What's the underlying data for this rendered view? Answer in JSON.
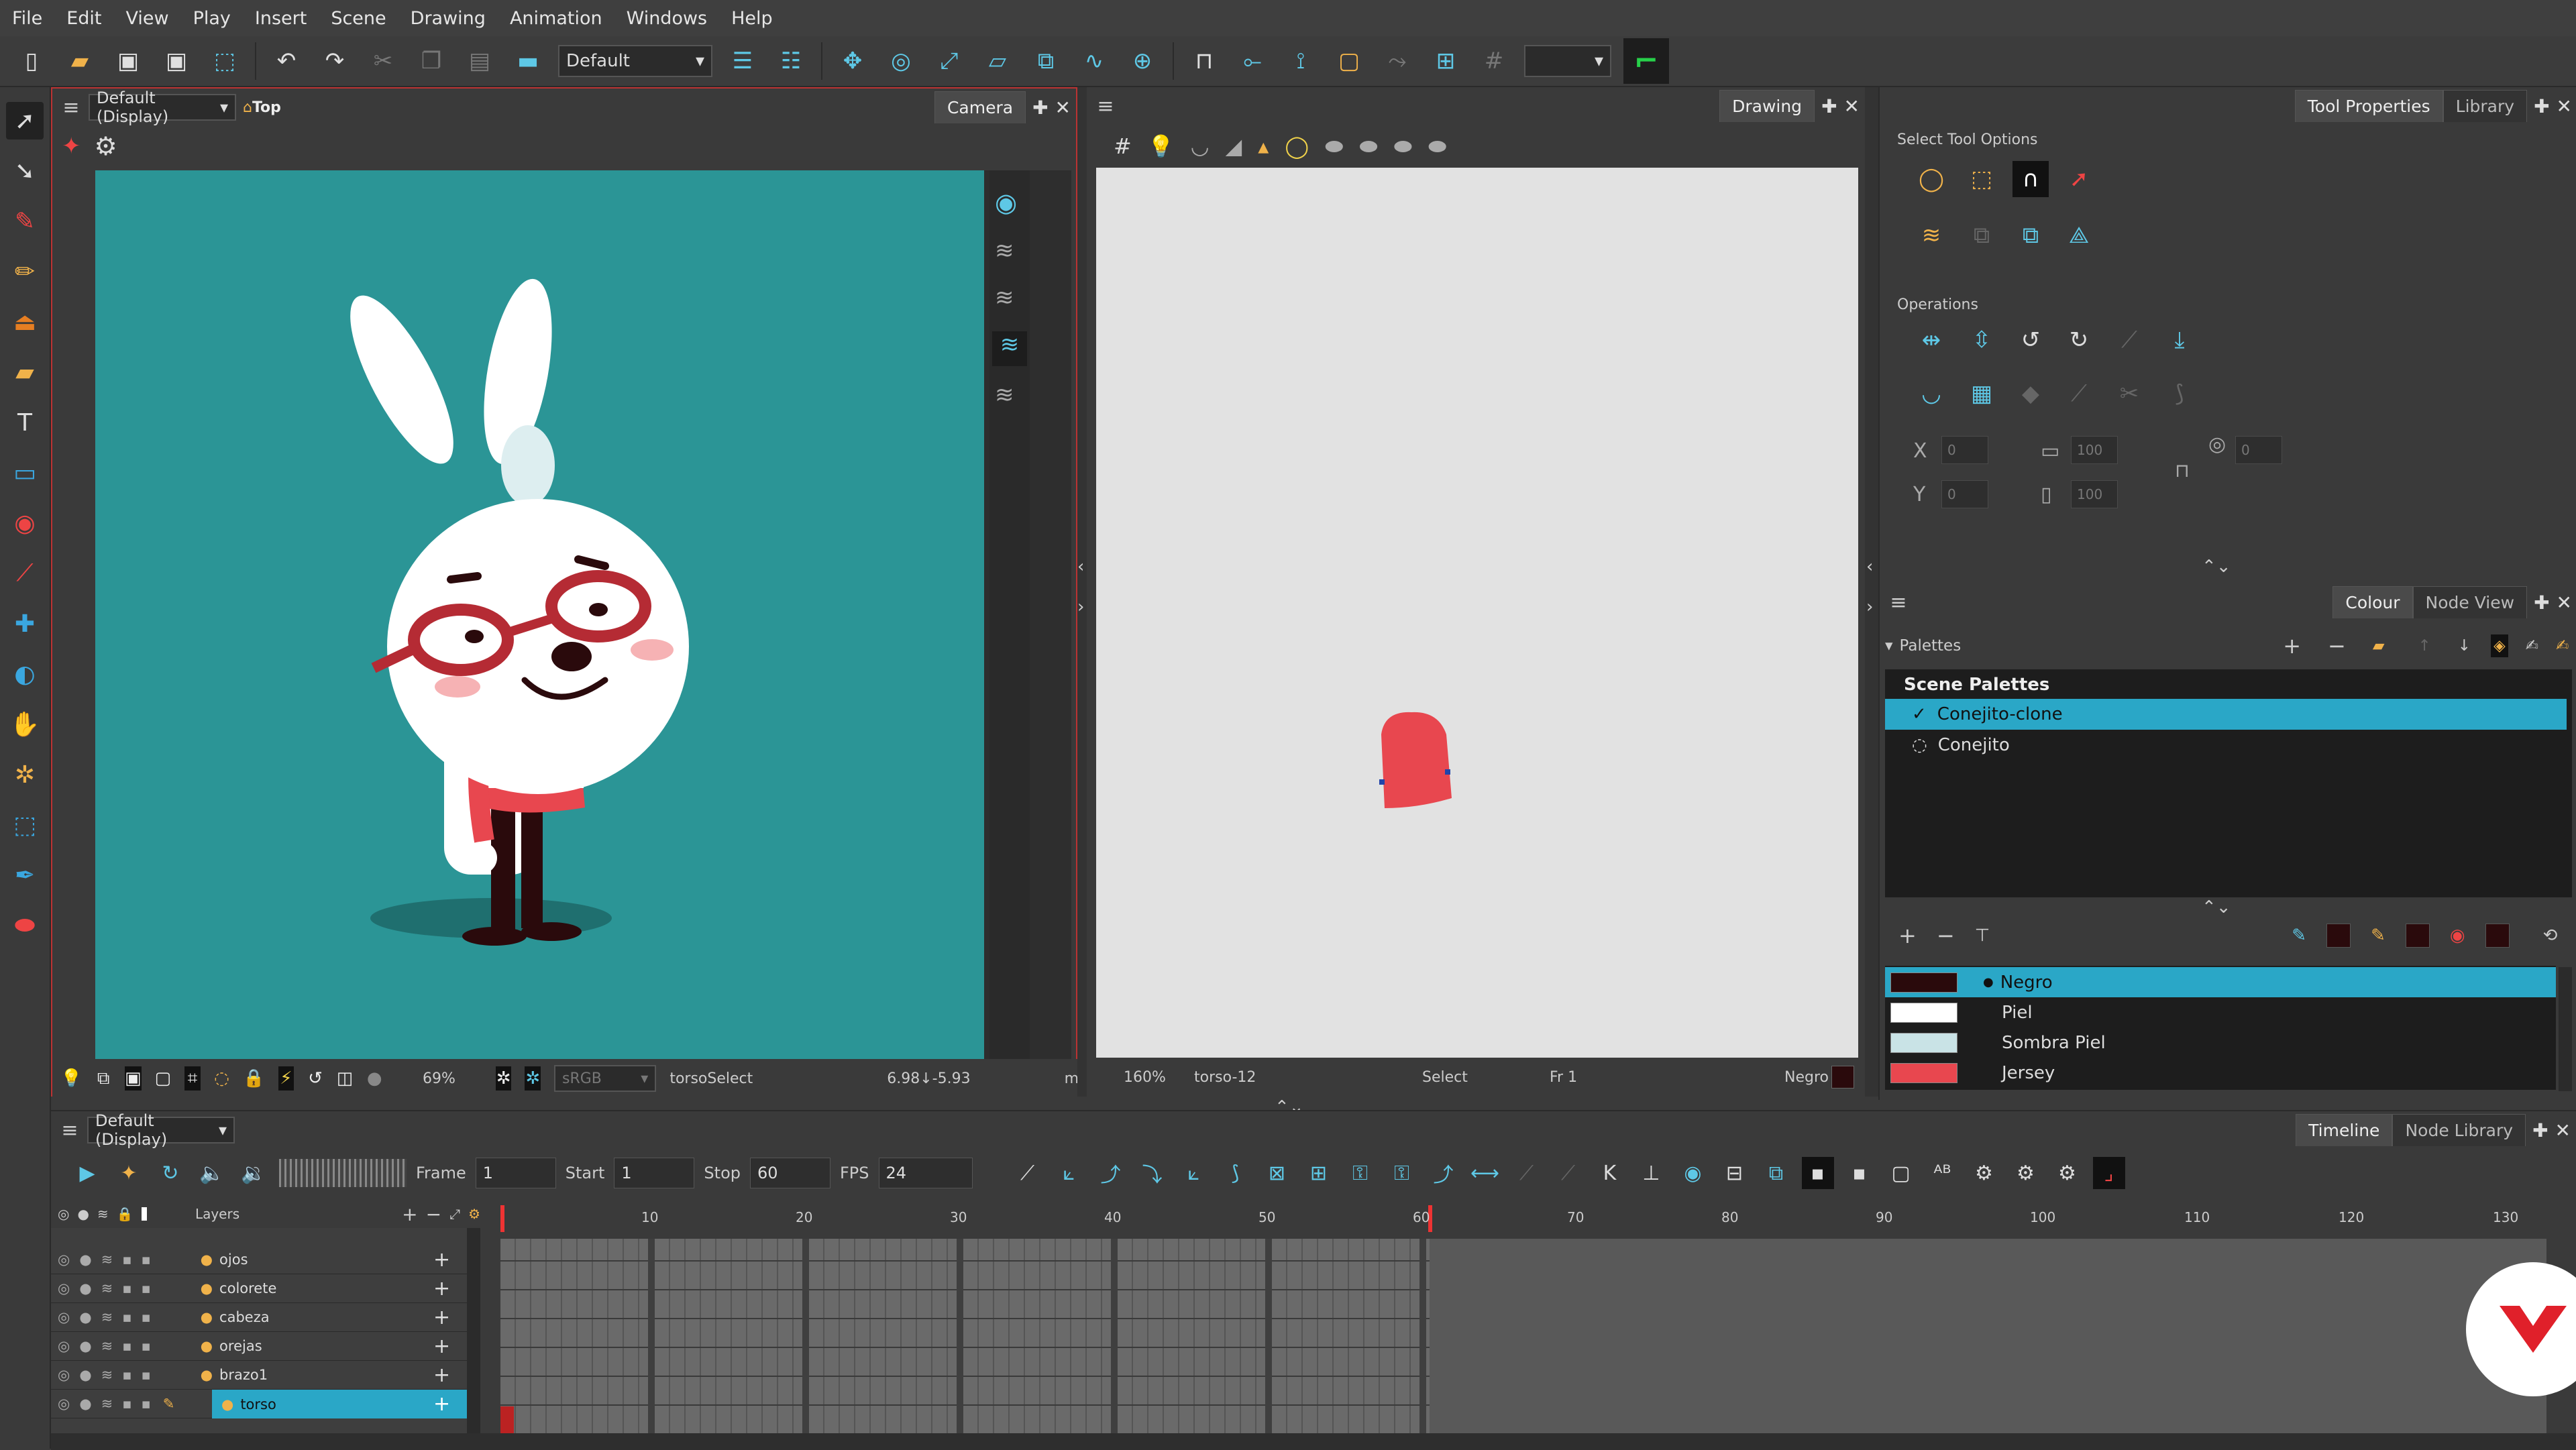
{
  "menu": [
    "File",
    "Edit",
    "View",
    "Play",
    "Insert",
    "Scene",
    "Drawing",
    "Animation",
    "Windows",
    "Help"
  ],
  "toolbar": {
    "workspace": "Default"
  },
  "camera_view": {
    "display": "Default (Display)",
    "view_mode": "Top",
    "tab": "Camera",
    "zoom": "69%",
    "color_space": "sRGB",
    "tool_label": "torsoSelect",
    "coords": "6.98↓-5.93",
    "unit": "m"
  },
  "drawing_view": {
    "tab": "Drawing",
    "zoom": "160%",
    "drawing_name": "torso-12",
    "tool": "Select",
    "frame": "Fr 1",
    "colour": "Negro"
  },
  "tool_properties": {
    "tabs": [
      "Tool Properties",
      "Library"
    ],
    "select_options_label": "Select Tool Options",
    "operations_label": "Operations",
    "fields": {
      "x": "0",
      "y": "0",
      "w": "100",
      "h": "100",
      "angle": "0"
    }
  },
  "colour_panel": {
    "tabs": [
      "Colour",
      "Node View"
    ],
    "palettes_label": "Palettes",
    "scene_palettes_label": "Scene Palettes",
    "palettes": [
      {
        "name": "Conejito-clone",
        "selected": true
      },
      {
        "name": "Conejito",
        "selected": false
      }
    ],
    "swatches": [
      {
        "name": "Negro",
        "color": "#2a0a0c",
        "selected": true
      },
      {
        "name": "Piel",
        "color": "#ffffff",
        "selected": false
      },
      {
        "name": "Sombra Piel",
        "color": "#c9e3e6",
        "selected": false
      },
      {
        "name": "Jersey",
        "color": "#e8474f",
        "selected": false
      }
    ]
  },
  "timeline": {
    "display": "Default (Display)",
    "tabs": [
      "Timeline",
      "Node Library"
    ],
    "frame_label": "Frame",
    "frame_value": "1",
    "start_label": "Start",
    "start_value": "1",
    "stop_label": "Stop",
    "stop_value": "60",
    "fps_label": "FPS",
    "fps_value": "24",
    "layers_label": "Layers",
    "layers": [
      "ojos",
      "colorete",
      "cabeza",
      "orejas",
      "brazo1",
      "torso"
    ],
    "ruler_marks": [
      "10",
      "20",
      "30",
      "40",
      "50",
      "60",
      "70",
      "80",
      "90",
      "100",
      "110",
      "120",
      "130"
    ]
  }
}
